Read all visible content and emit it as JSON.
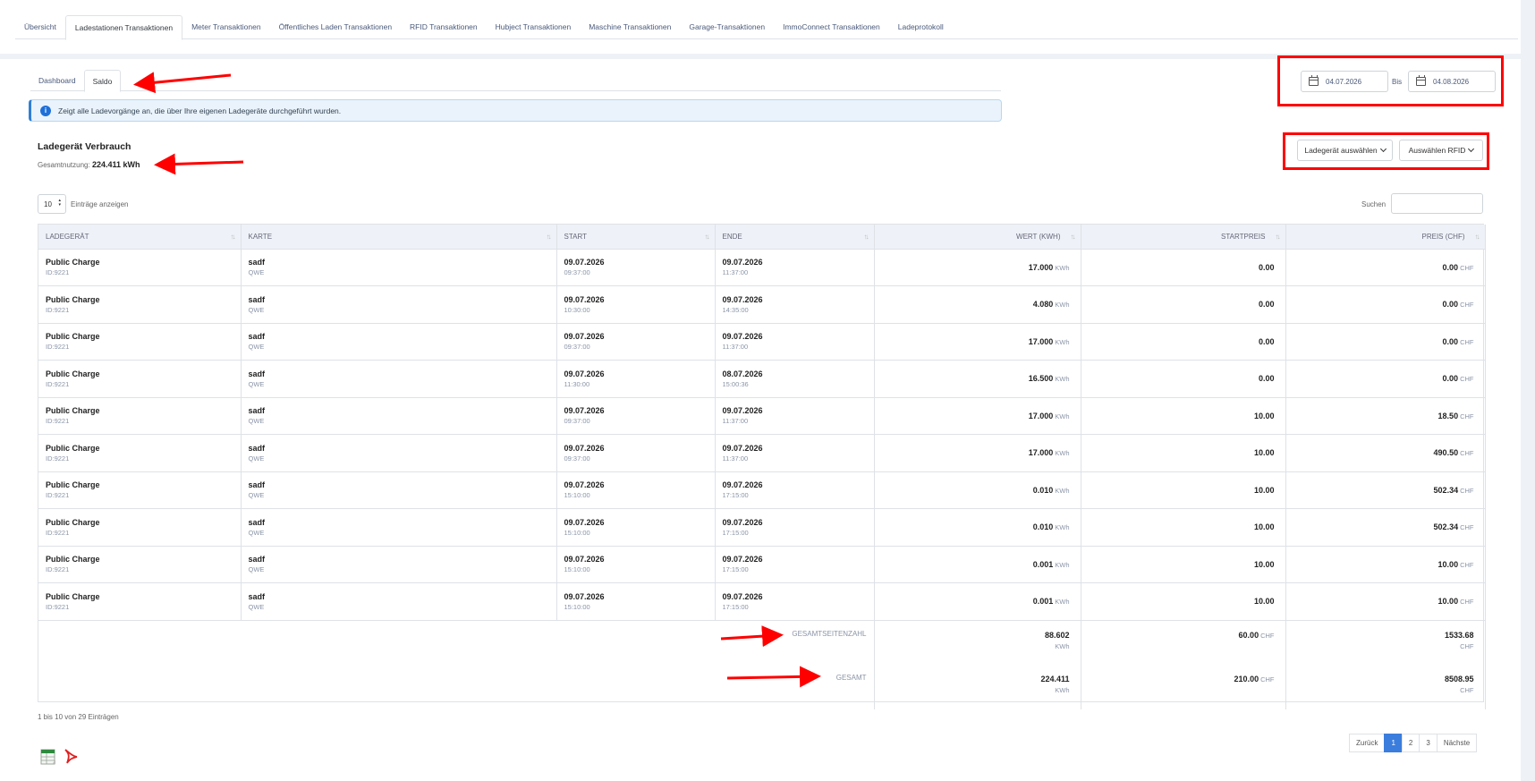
{
  "main_tabs": [
    "Übersicht",
    "Ladestationen Transaktionen",
    "Meter Transaktionen",
    "Öffentliches Laden Transaktionen",
    "RFID Transaktionen",
    "Hubject Transaktionen",
    "Maschine Transaktionen",
    "Garage-Transaktionen",
    "ImmoConnect Transaktionen",
    "Ladeprotokoll"
  ],
  "sub_tabs": [
    "Dashboard",
    "Saldo"
  ],
  "info_text": "Zeigt alle Ladevorgänge an, die über Ihre eigenen Ladegeräte durchgeführt wurden.",
  "section": {
    "title": "Ladegerät Verbrauch",
    "usage_label": "Gesamtnutzung:",
    "usage_value": "224.411 kWh"
  },
  "date_range": {
    "from": "04.07.2026",
    "bis_label": "Bis",
    "to": "04.08.2026"
  },
  "filters": {
    "charger": "Ladegerät auswählen",
    "rfid": "Auswählen RFID"
  },
  "entries": {
    "value": "10",
    "label": "Einträge anzeigen"
  },
  "search_label": "Suchen",
  "columns": [
    "LADEGERÄT",
    "KARTE",
    "START",
    "ENDE",
    "WERT (KWH)",
    "STARTPREIS",
    "PREIS (CHF)"
  ],
  "rows": [
    {
      "charger": "Public Charge",
      "charger_id": "ID:9221",
      "card": "sadf",
      "card_sub": "QWE",
      "start_date": "09.07.2026",
      "start_time": "09:37:00",
      "end_date": "09.07.2026",
      "end_time": "11:37:00",
      "kwh": "17.000",
      "start_price": "0.00",
      "price": "0.00"
    },
    {
      "charger": "Public Charge",
      "charger_id": "ID:9221",
      "card": "sadf",
      "card_sub": "QWE",
      "start_date": "09.07.2026",
      "start_time": "10:30:00",
      "end_date": "09.07.2026",
      "end_time": "14:35:00",
      "kwh": "4.080",
      "start_price": "0.00",
      "price": "0.00"
    },
    {
      "charger": "Public Charge",
      "charger_id": "ID:9221",
      "card": "sadf",
      "card_sub": "QWE",
      "start_date": "09.07.2026",
      "start_time": "09:37:00",
      "end_date": "09.07.2026",
      "end_time": "11:37:00",
      "kwh": "17.000",
      "start_price": "0.00",
      "price": "0.00"
    },
    {
      "charger": "Public Charge",
      "charger_id": "ID:9221",
      "card": "sadf",
      "card_sub": "QWE",
      "start_date": "09.07.2026",
      "start_time": "11:30:00",
      "end_date": "08.07.2026",
      "end_time": "15:00:36",
      "kwh": "16.500",
      "start_price": "0.00",
      "price": "0.00"
    },
    {
      "charger": "Public Charge",
      "charger_id": "ID:9221",
      "card": "sadf",
      "card_sub": "QWE",
      "start_date": "09.07.2026",
      "start_time": "09:37:00",
      "end_date": "09.07.2026",
      "end_time": "11:37:00",
      "kwh": "17.000",
      "start_price": "10.00",
      "price": "18.50"
    },
    {
      "charger": "Public Charge",
      "charger_id": "ID:9221",
      "card": "sadf",
      "card_sub": "QWE",
      "start_date": "09.07.2026",
      "start_time": "09:37:00",
      "end_date": "09.07.2026",
      "end_time": "11:37:00",
      "kwh": "17.000",
      "start_price": "10.00",
      "price": "490.50"
    },
    {
      "charger": "Public Charge",
      "charger_id": "ID:9221",
      "card": "sadf",
      "card_sub": "QWE",
      "start_date": "09.07.2026",
      "start_time": "15:10:00",
      "end_date": "09.07.2026",
      "end_time": "17:15:00",
      "kwh": "0.010",
      "start_price": "10.00",
      "price": "502.34"
    },
    {
      "charger": "Public Charge",
      "charger_id": "ID:9221",
      "card": "sadf",
      "card_sub": "QWE",
      "start_date": "09.07.2026",
      "start_time": "15:10:00",
      "end_date": "09.07.2026",
      "end_time": "17:15:00",
      "kwh": "0.010",
      "start_price": "10.00",
      "price": "502.34"
    },
    {
      "charger": "Public Charge",
      "charger_id": "ID:9221",
      "card": "sadf",
      "card_sub": "QWE",
      "start_date": "09.07.2026",
      "start_time": "15:10:00",
      "end_date": "09.07.2026",
      "end_time": "17:15:00",
      "kwh": "0.001",
      "start_price": "10.00",
      "price": "10.00"
    },
    {
      "charger": "Public Charge",
      "charger_id": "ID:9221",
      "card": "sadf",
      "card_sub": "QWE",
      "start_date": "09.07.2026",
      "start_time": "15:10:00",
      "end_date": "09.07.2026",
      "end_time": "17:15:00",
      "kwh": "0.001",
      "start_price": "10.00",
      "price": "10.00"
    }
  ],
  "units": {
    "kwh": "KWh",
    "chf": "CHF"
  },
  "footer": {
    "page_total": {
      "label": "GESAMTSEITENZAHL",
      "kwh": "88.602",
      "kwh_unit": "KWh",
      "start_price": "60.00",
      "start_unit": "CHF",
      "price": "1533.68",
      "price_unit": "CHF"
    },
    "total": {
      "label": "GESAMT",
      "kwh": "224.411",
      "kwh_unit": "KWh",
      "start_price": "210.00",
      "start_unit": "CHF",
      "price": "8508.95",
      "price_unit": "CHF"
    }
  },
  "pagination_info": "1 bis 10 von 29 Einträgen",
  "pagination": {
    "prev": "Zurück",
    "pages": [
      "1",
      "2",
      "3"
    ],
    "next": "Nächste"
  },
  "colors": {
    "accent": "#3b7ddd",
    "highlight": "#ff0000",
    "info_bg": "#eaf3fb"
  },
  "icons": {
    "excel": "excel-export-icon",
    "pdf": "pdf-export-icon",
    "calendar": "calendar-icon",
    "info": "info-icon"
  }
}
